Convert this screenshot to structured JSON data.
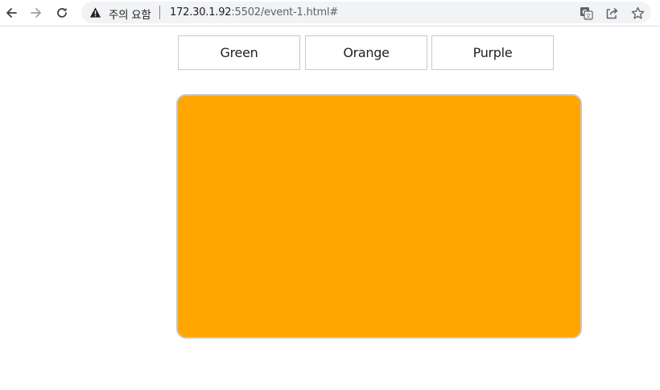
{
  "browser": {
    "security_label": "주의 요함",
    "url_host": "172.30.1.92",
    "url_path": ":5502/event-1.html#"
  },
  "buttons": [
    {
      "label": "Green"
    },
    {
      "label": "Orange"
    },
    {
      "label": "Purple"
    }
  ],
  "box": {
    "color": "#ffa500",
    "color_name": "orange"
  },
  "icons": {
    "back": "back-arrow-icon",
    "forward": "forward-arrow-icon",
    "reload": "reload-icon",
    "warning": "warning-icon",
    "translate": "translate-icon",
    "share": "share-icon",
    "bookmark": "star-icon"
  }
}
